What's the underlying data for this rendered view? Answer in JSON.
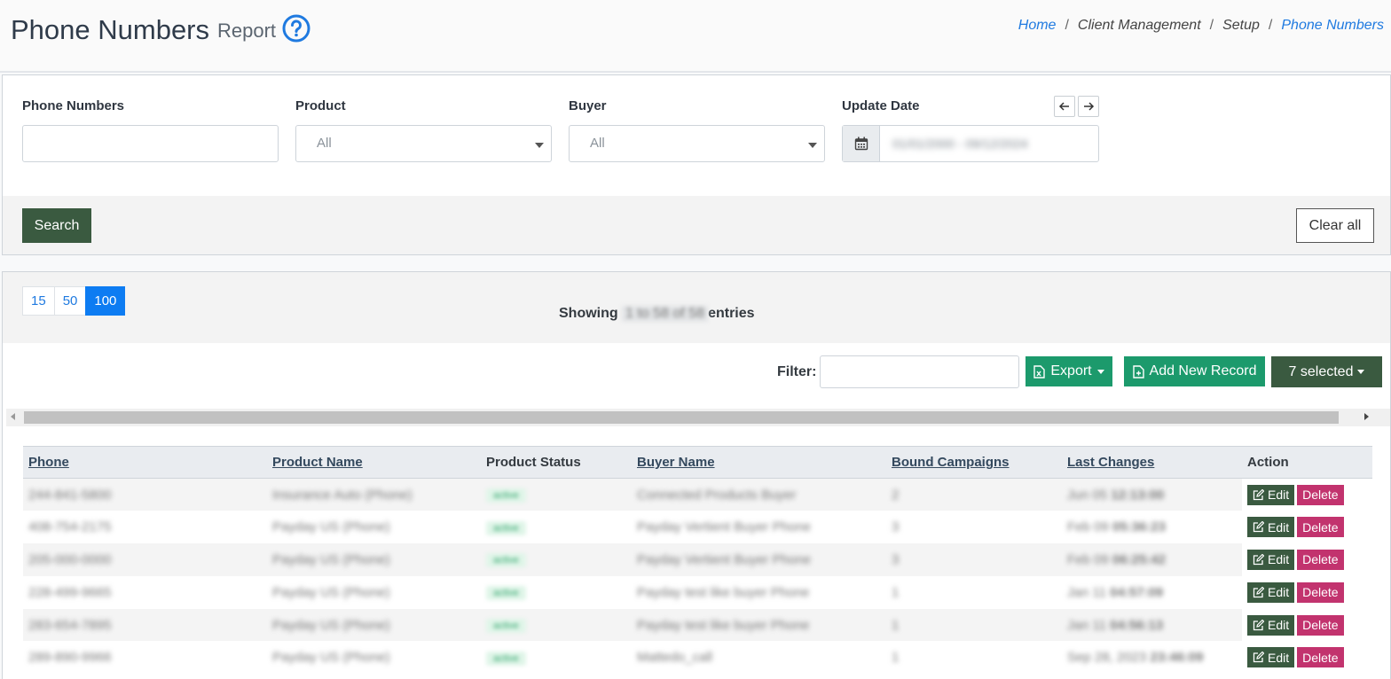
{
  "header": {
    "title": "Phone Numbers",
    "subtitle": "Report",
    "breadcrumb": [
      {
        "label": "Home",
        "link": true
      },
      {
        "label": "Client Management",
        "link": false
      },
      {
        "label": "Setup",
        "link": false
      },
      {
        "label": "Phone Numbers",
        "link": true
      }
    ]
  },
  "filters": {
    "phone_label": "Phone Numbers",
    "phone_value": "",
    "product_label": "Product",
    "product_value": "All",
    "buyer_label": "Buyer",
    "buyer_value": "All",
    "date_label": "Update Date",
    "date_value": "01/01/2000 - 09/12/2024",
    "search_label": "Search",
    "clear_label": "Clear all"
  },
  "table_controls": {
    "page_sizes": [
      "15",
      "50",
      "100"
    ],
    "active_page_size": "100",
    "showing_prefix": "Showing",
    "showing_range": "1 to 58 of 58",
    "showing_suffix": "entries",
    "filter_label": "Filter:",
    "filter_value": "",
    "export_label": "Export",
    "add_label": "Add New Record",
    "selected_label": "7 selected"
  },
  "table": {
    "columns": [
      "Phone",
      "Product Name",
      "Product Status",
      "Buyer Name",
      "Bound Campaigns",
      "Last Changes",
      "Action"
    ],
    "edit_label": "Edit",
    "delete_label": "Delete",
    "rows": [
      {
        "phone": "244-841-5800",
        "product": "Insurance Auto (Phone)",
        "status": "active",
        "buyer": "Connected Products Buyer",
        "campaigns": "2",
        "changed_date": "Jun 05",
        "changed_time": "12:13:00"
      },
      {
        "phone": "408-754-2175",
        "product": "Payday US (Phone)",
        "status": "active",
        "buyer": "Payday Vertient Buyer Phone",
        "campaigns": "3",
        "changed_date": "Feb 09",
        "changed_time": "05:36:23"
      },
      {
        "phone": "205-000-0000",
        "product": "Payday US (Phone)",
        "status": "active",
        "buyer": "Payday Vertient Buyer Phone",
        "campaigns": "3",
        "changed_date": "Feb 09",
        "changed_time": "06:25:42"
      },
      {
        "phone": "228-499-9665",
        "product": "Payday US (Phone)",
        "status": "active",
        "buyer": "Payday test like buyer Phone",
        "campaigns": "1",
        "changed_date": "Jan 11",
        "changed_time": "04:57:09"
      },
      {
        "phone": "283-654-7895",
        "product": "Payday US (Phone)",
        "status": "active",
        "buyer": "Payday test like buyer Phone",
        "campaigns": "1",
        "changed_date": "Jan 11",
        "changed_time": "04:56:13"
      },
      {
        "phone": "289-890-9966",
        "product": "Payday US (Phone)",
        "status": "active",
        "buyer": "Mattedo_call",
        "campaigns": "1",
        "changed_date": "Sep 28, 2023",
        "changed_time": "23:46:09"
      }
    ]
  },
  "colors": {
    "primary_dark_green": "#3a5a40",
    "export_green": "#1c9a6c",
    "delete_pink": "#c2336e",
    "link_blue": "#1f7ae0",
    "pager_active": "#0d7cf2"
  }
}
